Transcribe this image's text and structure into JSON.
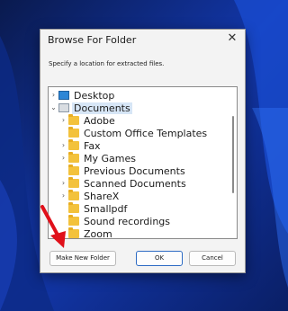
{
  "dialog": {
    "title": "Browse For Folder",
    "close_glyph": "✕",
    "instruction": "Specify a location for extracted files."
  },
  "tree": {
    "items": [
      {
        "label": "Desktop",
        "chevron": "›",
        "icon": "desktop-icon"
      },
      {
        "label": "Documents",
        "chevron": "⌄",
        "icon": "documents-icon"
      },
      {
        "label": "Adobe",
        "chevron": "›",
        "icon": "folder-icon"
      },
      {
        "label": "Custom Office Templates",
        "chevron": "",
        "icon": "folder-icon"
      },
      {
        "label": "Fax",
        "chevron": "›",
        "icon": "folder-icon"
      },
      {
        "label": "My Games",
        "chevron": "›",
        "icon": "folder-icon"
      },
      {
        "label": "Previous Documents",
        "chevron": "",
        "icon": "folder-icon"
      },
      {
        "label": "Scanned Documents",
        "chevron": "›",
        "icon": "folder-icon"
      },
      {
        "label": "ShareX",
        "chevron": "›",
        "icon": "folder-icon"
      },
      {
        "label": "Smallpdf",
        "chevron": "",
        "icon": "folder-icon"
      },
      {
        "label": "Sound recordings",
        "chevron": "",
        "icon": "folder-icon"
      },
      {
        "label": "Zoom",
        "chevron": "",
        "icon": "folder-icon"
      }
    ]
  },
  "buttons": {
    "make_new_folder": "Make New Folder",
    "ok": "OK",
    "cancel": "Cancel"
  },
  "colors": {
    "accent": "#2d6bc4",
    "selection": "#d7e6f6",
    "annotation_arrow": "#e0101a"
  }
}
